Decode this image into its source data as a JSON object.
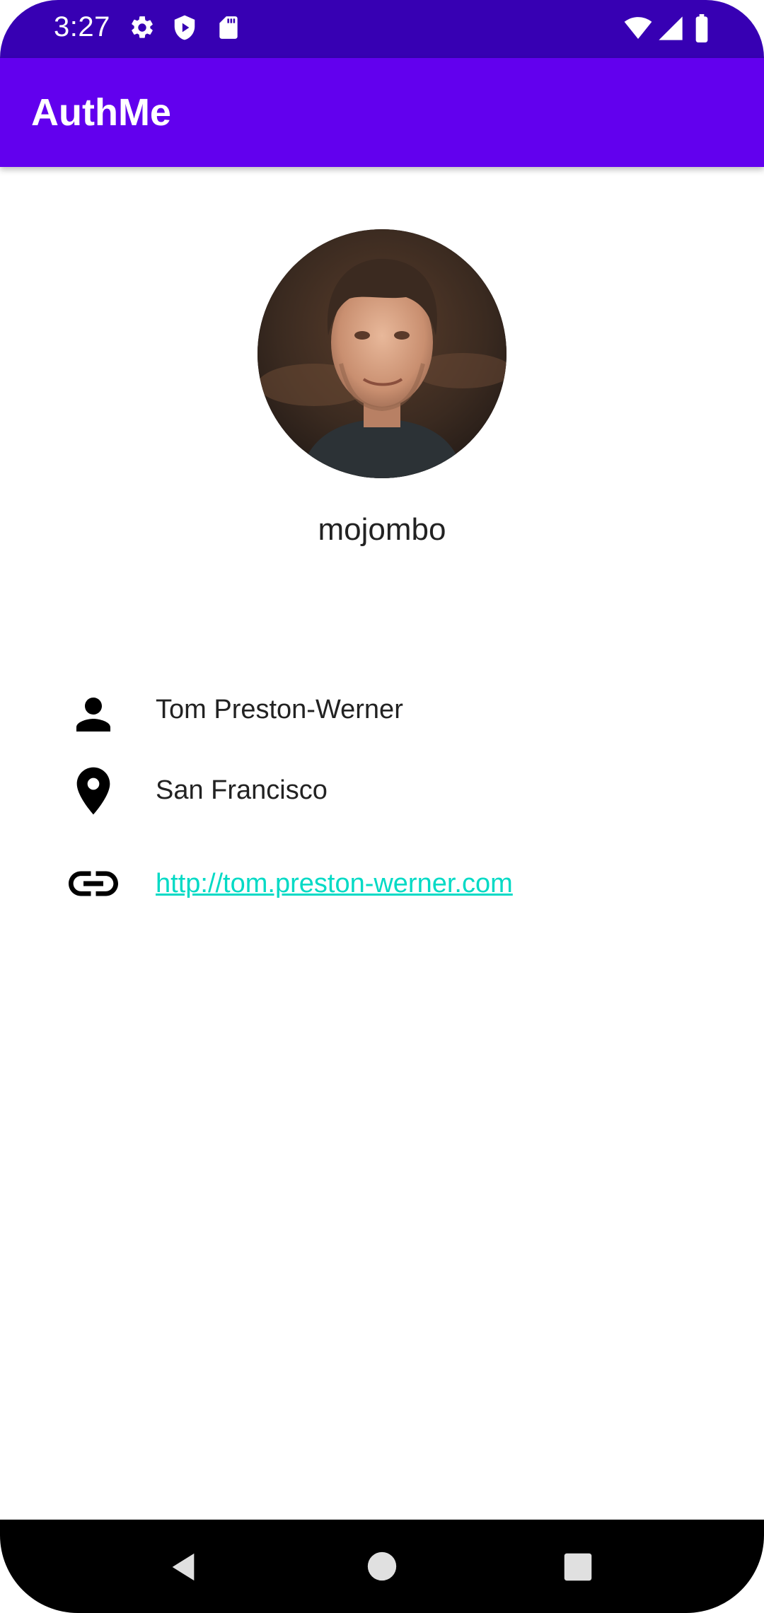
{
  "status_bar": {
    "time": "3:27",
    "left_icons": [
      "gear-icon",
      "shield-play-icon",
      "sd-card-icon"
    ],
    "right_icons": [
      "wifi-icon",
      "signal-icon",
      "battery-icon"
    ]
  },
  "app_bar": {
    "title": "AuthMe"
  },
  "profile": {
    "avatar": "profile-photo",
    "username": "mojombo",
    "name": "Tom Preston-Werner",
    "location": "San Francisco",
    "website": "http://tom.preston-werner.com"
  },
  "icons": {
    "name": "person-icon",
    "location": "location-pin-icon",
    "website": "link-icon"
  },
  "nav_bar": {
    "buttons": [
      "back-icon",
      "home-icon",
      "recents-icon"
    ]
  },
  "colors": {
    "status_bar": "#3700b3",
    "app_bar": "#6200ee",
    "link": "#03dac5",
    "nav_bar": "#000000"
  }
}
